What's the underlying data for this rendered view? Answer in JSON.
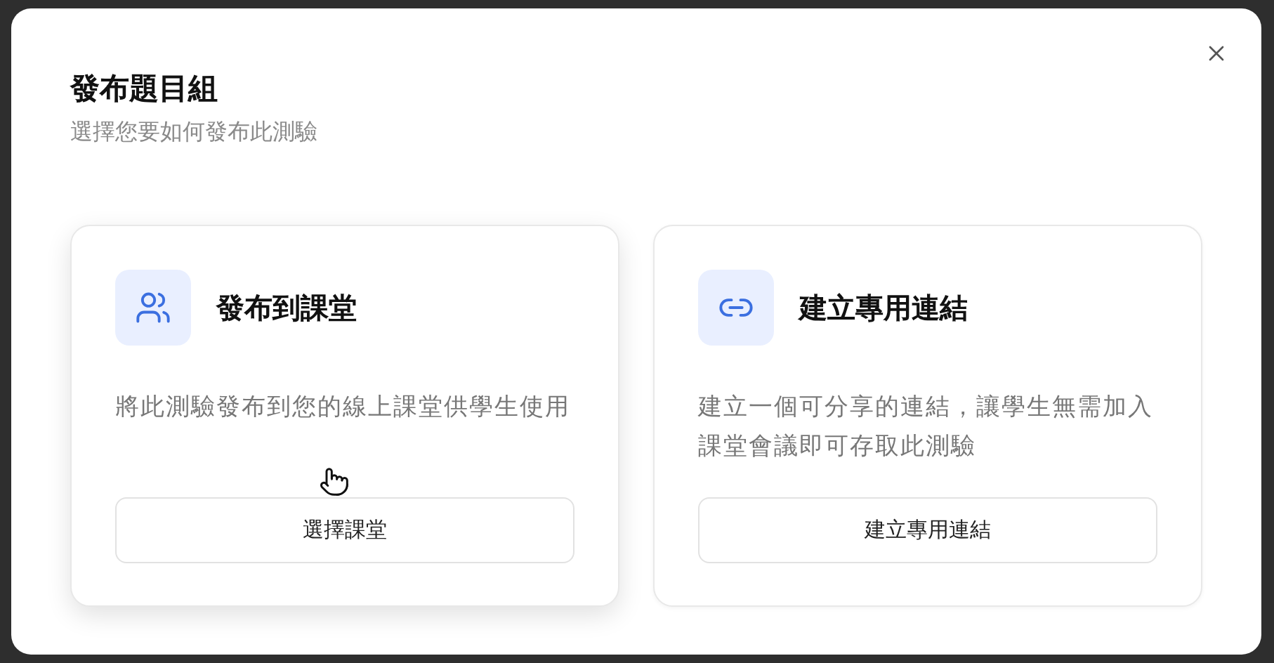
{
  "dialog": {
    "title": "發布題目組",
    "subtitle": "選擇您要如何發布此測驗"
  },
  "options": [
    {
      "kind": "classroom",
      "title": "發布到課堂",
      "description": "將此測驗發布到您的線上課堂供學生使用",
      "button": "選擇課堂",
      "hovered": true
    },
    {
      "kind": "link",
      "title": "建立專用連結",
      "description": "建立一個可分享的連結，讓學生無需加入課堂會議即可存取此測驗",
      "button": "建立專用連結",
      "hovered": false
    }
  ]
}
